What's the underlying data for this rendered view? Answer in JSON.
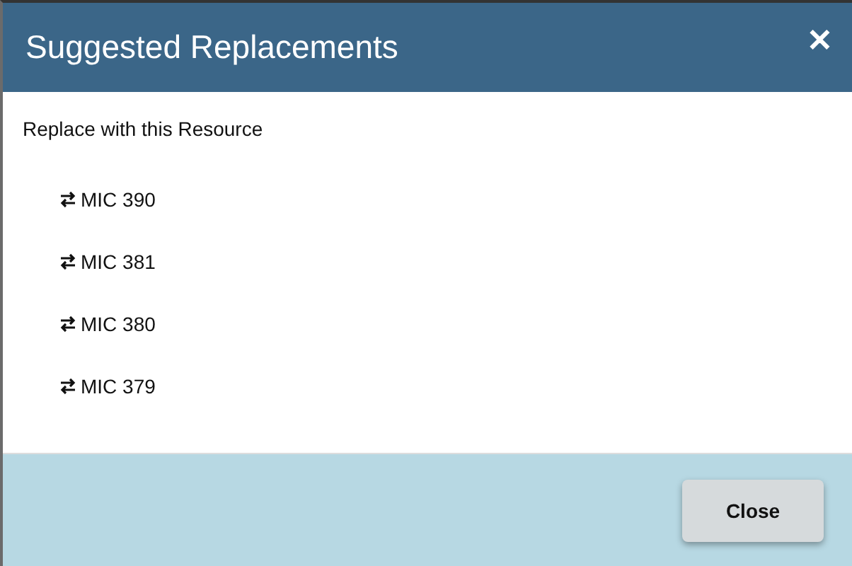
{
  "dialog": {
    "title": "Suggested Replacements",
    "close_icon": "✕"
  },
  "prompt": "Replace with this Resource",
  "resources": [
    {
      "label": "MIC 390"
    },
    {
      "label": "MIC 381"
    },
    {
      "label": "MIC 380"
    },
    {
      "label": "MIC 379"
    }
  ],
  "buttons": [
    "Close"
  ]
}
